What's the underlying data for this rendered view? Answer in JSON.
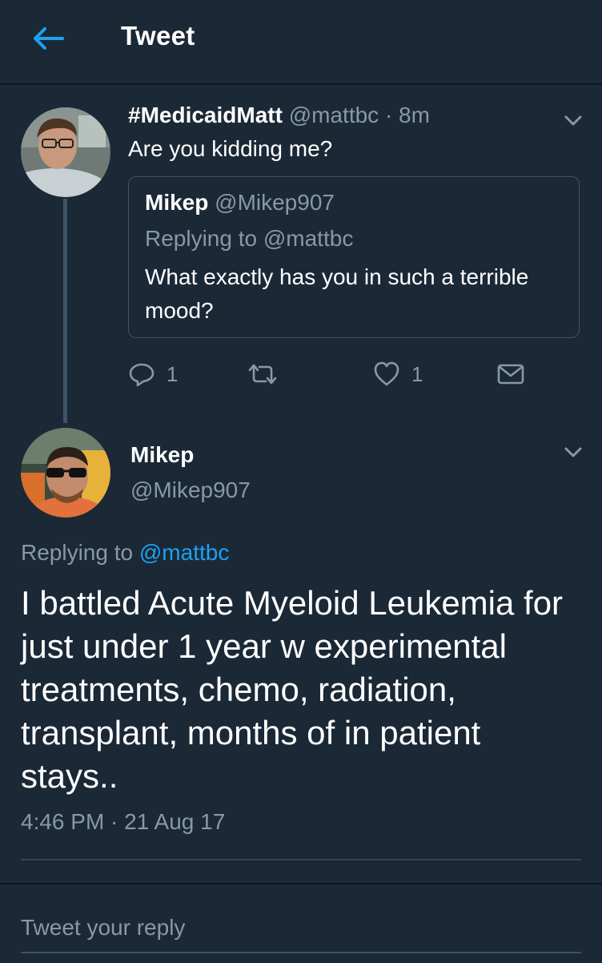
{
  "header": {
    "title": "Tweet"
  },
  "tweet_parent": {
    "display_name": "#MedicaidMatt",
    "handle": "@mattbc",
    "time": "· 8m",
    "text": "Are you kidding me?",
    "quoted": {
      "display_name": "Mikep",
      "handle": "@Mikep907",
      "replying_to": "Replying to @mattbc",
      "text": "What exactly has you in such a terrible mood?"
    },
    "actions": {
      "reply_count": "1",
      "like_count": "1"
    }
  },
  "tweet_main": {
    "display_name": "Mikep",
    "handle": "@Mikep907",
    "replying_prefix": "Replying to",
    "replying_handle": "@mattbc",
    "text": "I battled Acute Myeloid Leukemia for just under 1 year w experimental treatments, chemo, radiation, transplant, months of in patient stays..",
    "timestamp": "4:46 PM · 21 Aug 17"
  },
  "reply_bar": {
    "placeholder": "Tweet your reply"
  },
  "colors": {
    "background": "#1b2836",
    "accent": "#1da1f2",
    "muted": "#8899a6",
    "border": "#3d5466"
  },
  "icons": [
    "back-arrow-icon",
    "chevron-down-icon",
    "reply-icon",
    "retweet-icon",
    "like-icon",
    "message-icon"
  ]
}
